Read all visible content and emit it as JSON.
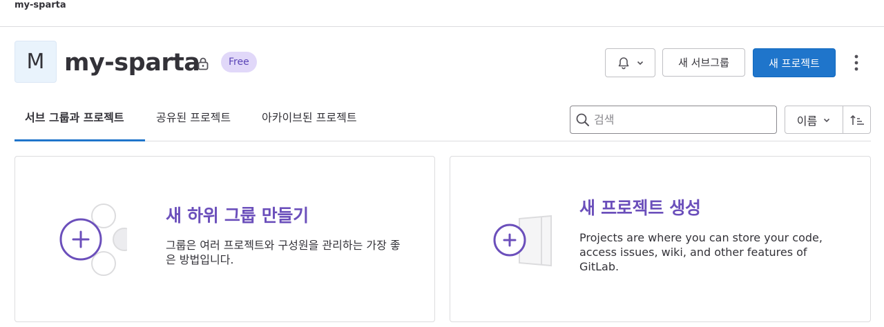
{
  "breadcrumb": {
    "label": "my-sparta"
  },
  "group": {
    "avatar_letter": "M",
    "title": "my-sparta",
    "plan_badge": "Free"
  },
  "actions": {
    "notifications_icon": "bell-icon",
    "new_subgroup_label": "새 서브그룹",
    "new_project_label": "새 프로젝트",
    "more_icon": "kebab-icon"
  },
  "tabs": [
    {
      "label": "서브 그룹과 프로젝트",
      "active": true
    },
    {
      "label": "공유된 프로젝트",
      "active": false
    },
    {
      "label": "아카이브된 프로젝트",
      "active": false
    }
  ],
  "search": {
    "placeholder": "검색",
    "value": ""
  },
  "sort": {
    "selected": "이름",
    "direction_icon": "sort-ascending-icon"
  },
  "cards": {
    "subgroup": {
      "title": "새 하위 그룹 만들기",
      "description": "그룹은 여러 프로젝트와 구성원을 관리하는 가장 좋은 방법입니다."
    },
    "project": {
      "title": "새 프로젝트 생성",
      "description": "Projects are where you can store your code, access issues, wiki, and other features of GitLab."
    }
  },
  "colors": {
    "accent": "#1f75cb",
    "purple": "#6b4fbb",
    "badge_bg": "#e1d8f9"
  }
}
